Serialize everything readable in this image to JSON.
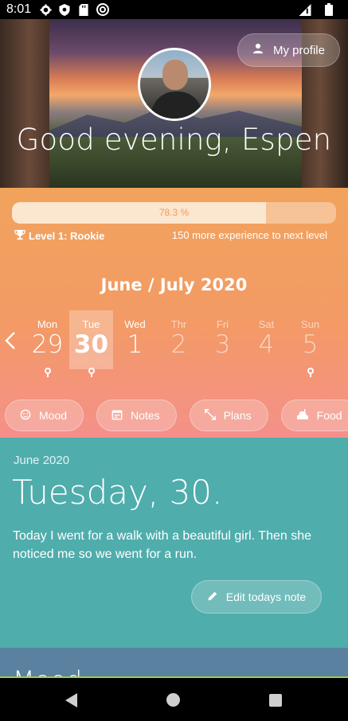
{
  "status_bar": {
    "time": "8:01"
  },
  "header": {
    "profile_button": "My profile",
    "greeting": "Good evening, Espen"
  },
  "progress": {
    "percent_text": "78.3 %",
    "percent_value": 78.3,
    "level_text": "Level 1: Rookie",
    "next_level_text": "150 more experience to next level"
  },
  "calendar": {
    "month_title": "June  / July 2020",
    "days": [
      {
        "name": "Mon",
        "num": "29",
        "state": "past",
        "pin": true
      },
      {
        "name": "Tue",
        "num": "30",
        "state": "selected",
        "pin": true
      },
      {
        "name": "Wed",
        "num": "1",
        "state": "past",
        "pin": false
      },
      {
        "name": "Thr",
        "num": "2",
        "state": "future",
        "pin": false
      },
      {
        "name": "Fri",
        "num": "3",
        "state": "future",
        "pin": false
      },
      {
        "name": "Sat",
        "num": "4",
        "state": "future",
        "pin": false
      },
      {
        "name": "Sun",
        "num": "5",
        "state": "future",
        "pin": true
      }
    ]
  },
  "chips": [
    {
      "label": "Mood",
      "icon": "smiley-icon"
    },
    {
      "label": "Notes",
      "icon": "calendar-note-icon"
    },
    {
      "label": "Plans",
      "icon": "expand-arrows-icon"
    },
    {
      "label": "Food",
      "icon": "food-icon"
    }
  ],
  "day_note": {
    "month_year": "June 2020",
    "day_title": "Tuesday, 30.",
    "note_text": "Today I went for a walk with a beautiful girl. Then she noticed me so we went for a run.",
    "edit_button": "Edit todays note"
  },
  "next_section_peek": "Mood"
}
